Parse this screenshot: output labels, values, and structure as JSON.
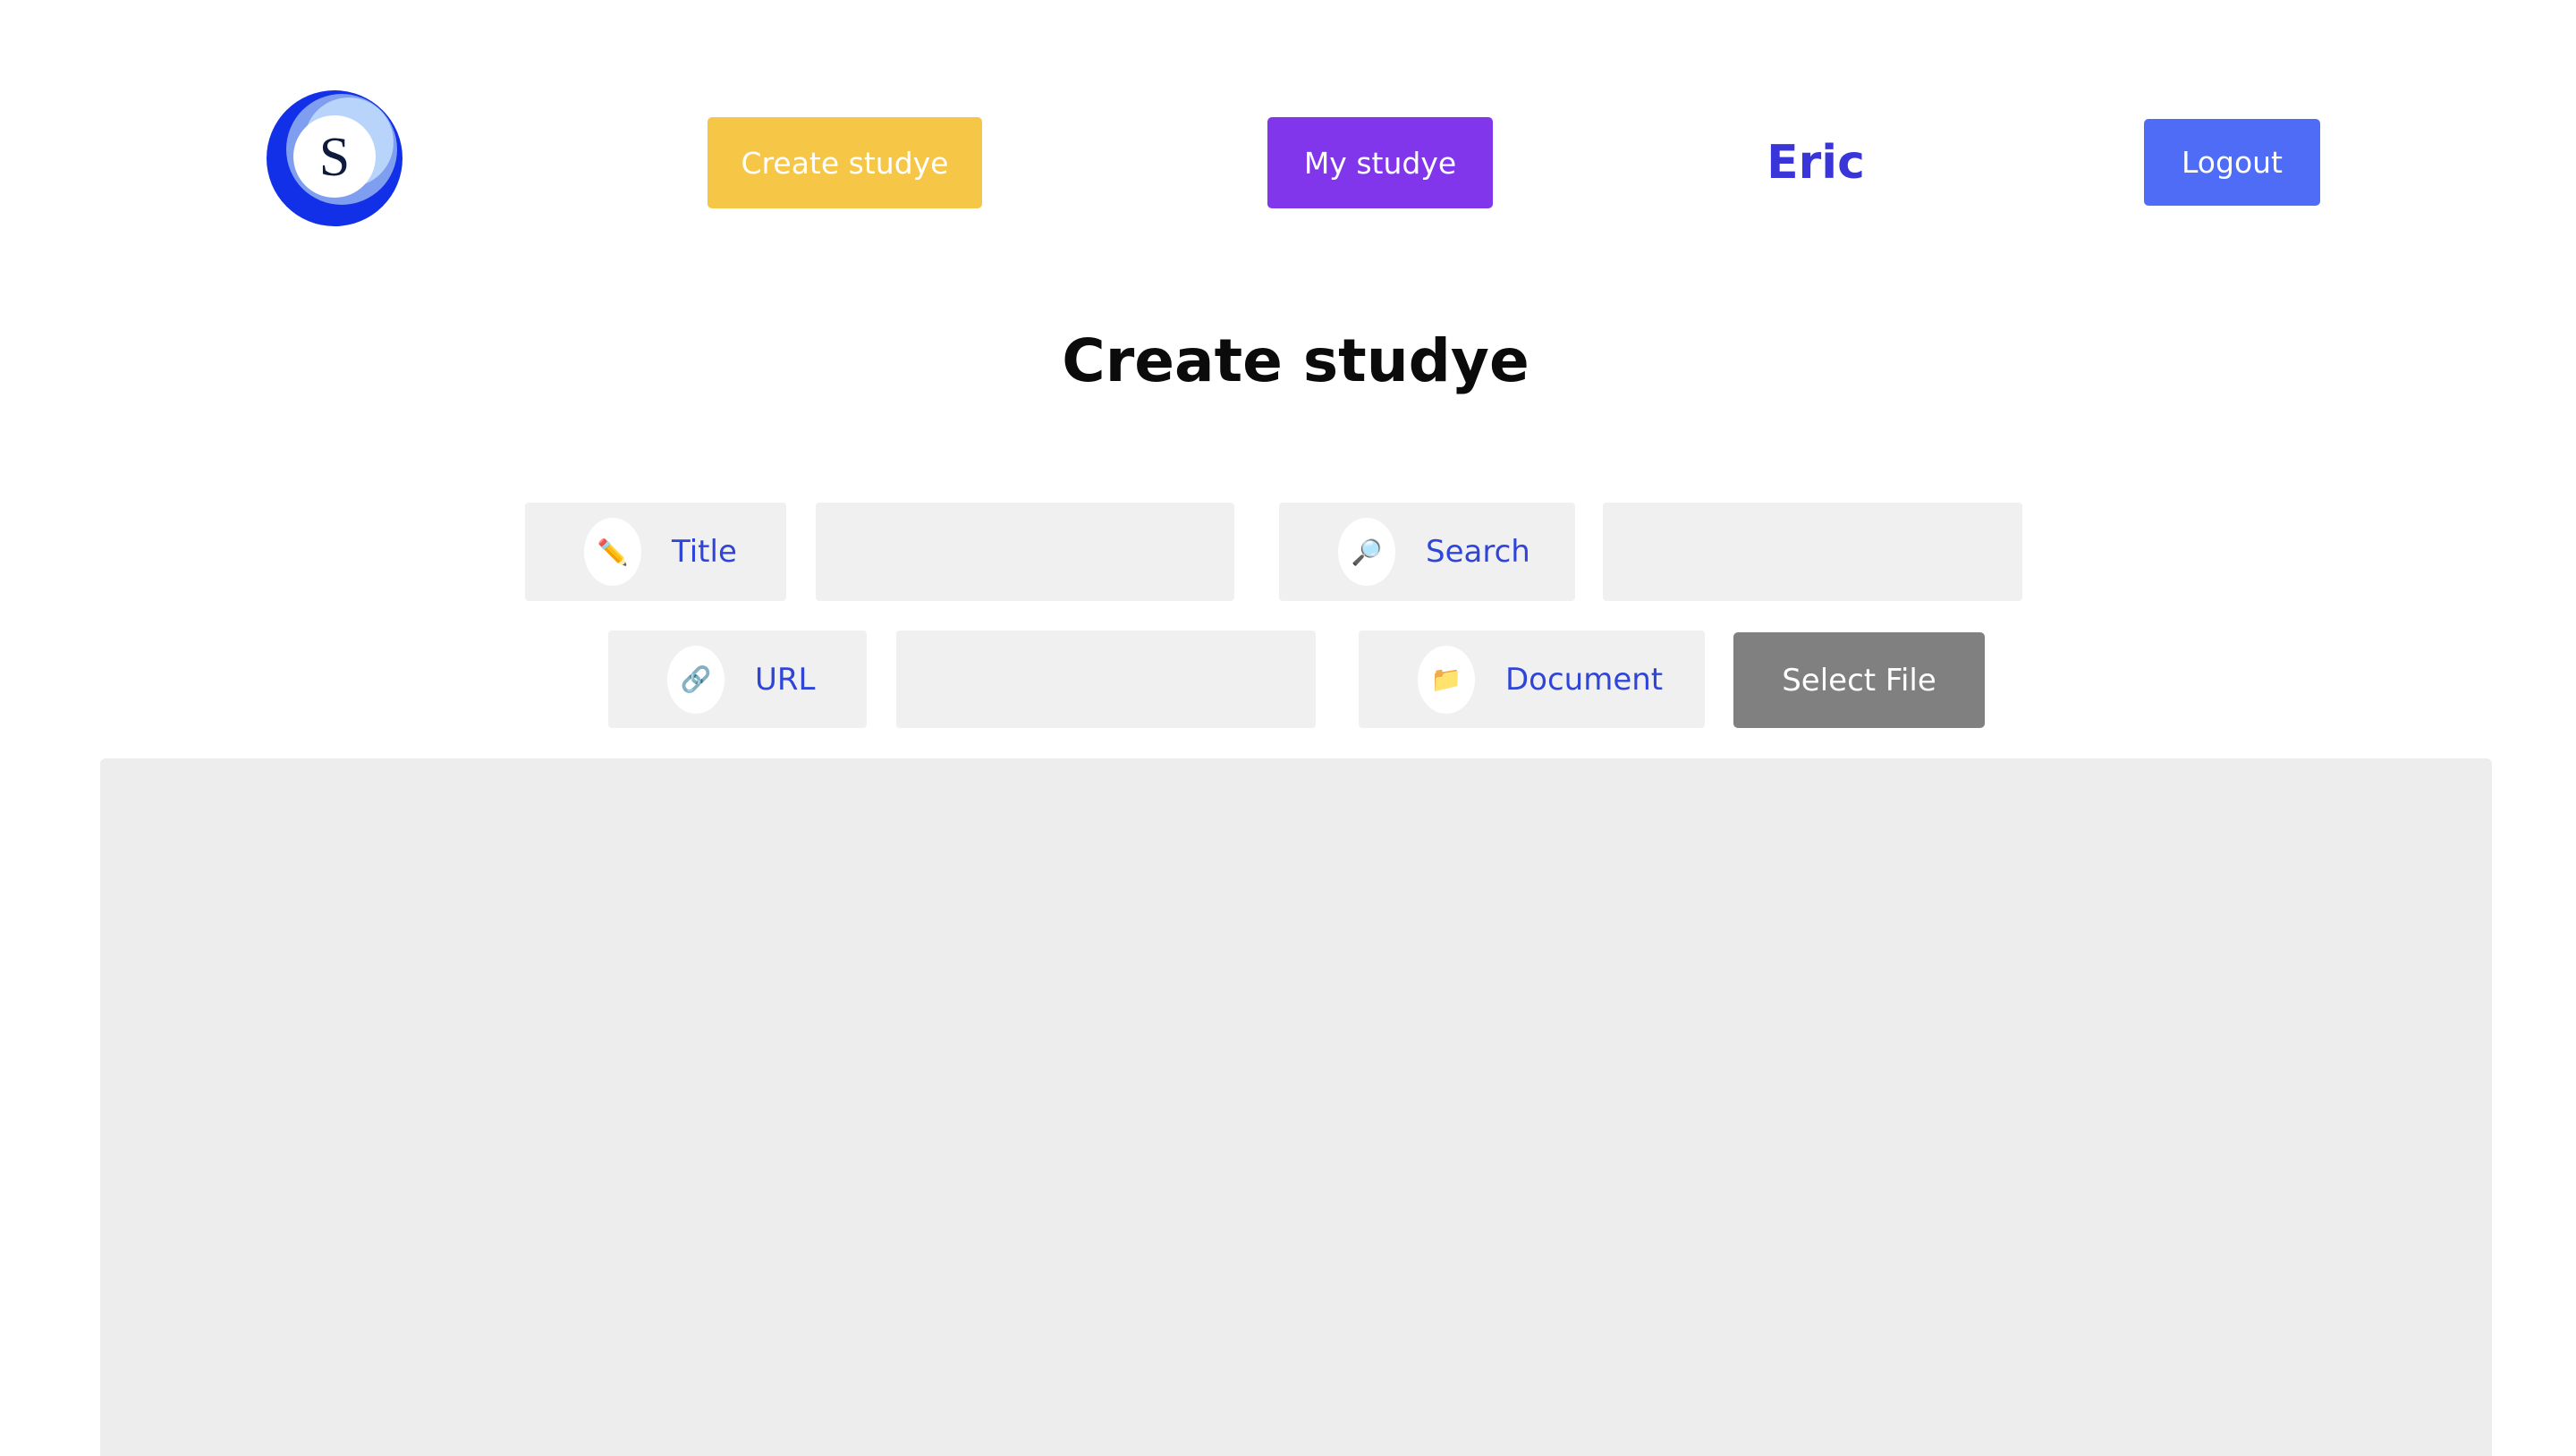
{
  "header": {
    "logo_letter": "S",
    "create_label": "Create studye",
    "my_label": "My studye",
    "username": "Eric",
    "logout_label": "Logout"
  },
  "main": {
    "title": "Create studye"
  },
  "form": {
    "title_label": "Title",
    "title_icon": "pencil-icon",
    "title_value": "",
    "search_label": "Search",
    "search_icon": "magnifier-icon",
    "search_value": "",
    "url_label": "URL",
    "url_icon": "link-icon",
    "url_value": "",
    "document_label": "Document",
    "document_icon": "folder-icon",
    "select_file_label": "Select File"
  },
  "colors": {
    "create_button": "#f6c646",
    "my_button": "#8236ec",
    "logout_button": "#4f6cf6",
    "username": "#3a35d9",
    "label_text": "#2f45d8",
    "select_file_button": "#808080"
  }
}
